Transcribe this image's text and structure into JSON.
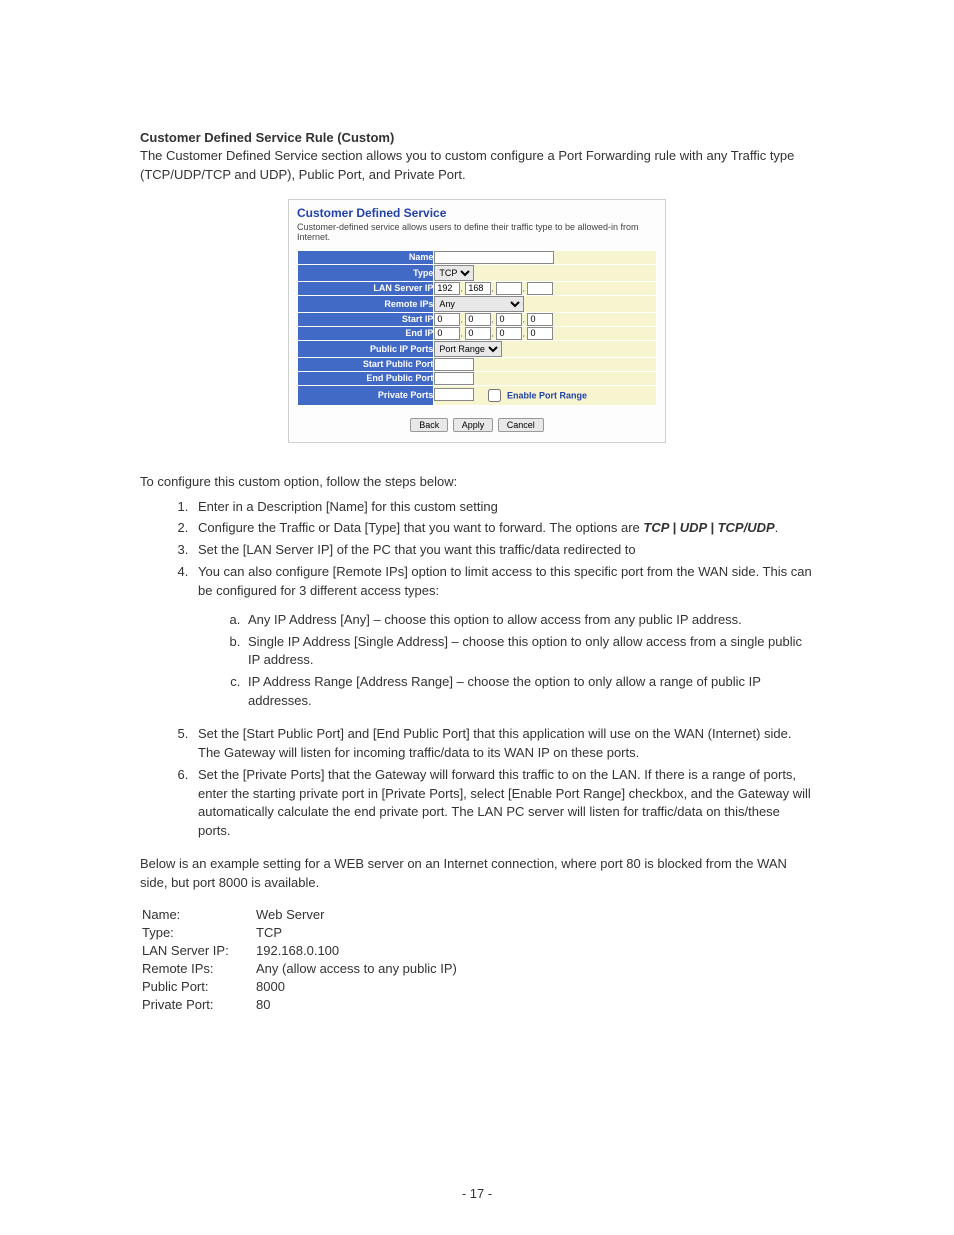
{
  "heading": "Customer Defined Service Rule (Custom)",
  "intro": "The Customer Defined Service section allows you to custom configure a Port Forwarding rule with any Traffic type (TCP/UDP/TCP and UDP), Public Port, and Private Port.",
  "shot": {
    "title": "Customer Defined Service",
    "desc": "Customer-defined service allows users to define their traffic type to be allowed-in from Internet.",
    "rows": {
      "name": "Name",
      "type": "Type",
      "lan_server_ip": "LAN Server IP",
      "remote_ips": "Remote IPs",
      "start_ip": "Start IP",
      "end_ip": "End IP",
      "public_ip_ports": "Public IP Ports",
      "start_public_port": "Start Public Port",
      "end_public_port": "End Public Port",
      "private_ports": "Private Ports"
    },
    "values": {
      "type_select": "TCP",
      "lan_ip_1": "192",
      "lan_ip_2": "168",
      "remote_select": "Any",
      "ip_zero": "0",
      "public_ports_select": "Port Range"
    },
    "checkbox_label": "Enable Port Range",
    "buttons": {
      "back": "Back",
      "apply": "Apply",
      "cancel": "Cancel"
    }
  },
  "configure_intro": "To configure this custom option, follow the steps below:",
  "steps": {
    "s1": "Enter in a Description [Name] for this custom setting",
    "s2a": "Configure the Traffic or Data [Type] that you want to forward.  The options are ",
    "s2b": "TCP | UDP | TCP/UDP",
    "s2c": ".",
    "s3": "Set the [LAN Server IP] of the PC that you want this traffic/data redirected to",
    "s4": "You can also configure [Remote IPs] option to limit access to this specific port from the WAN side. This can be configured for 3 different access types:",
    "s4a": "Any IP Address [Any] – choose this option to allow access from any public IP address.",
    "s4b": "Single IP Address [Single Address] – choose this option to only allow access from a single public IP address.",
    "s4c": "IP Address Range [Address Range] – choose the option to only allow a range of public IP addresses.",
    "s5": "Set the [Start Public Port] and [End Public Port] that this application will use on the WAN (Internet) side.  The Gateway will listen for incoming traffic/data to its WAN IP on these ports.",
    "s6": "Set the [Private Ports] that the Gateway will forward this traffic to on the LAN.  If there is a range of ports, enter the starting private port in [Private Ports], select [Enable Port Range] checkbox, and the Gateway will automatically calculate the end private port.  The LAN PC server will listen for traffic/data on this/these ports."
  },
  "example_intro": "Below is an example setting for a WEB server on an Internet connection, where port 80 is blocked from the WAN side, but port 8000 is available.",
  "example": {
    "name_l": "Name:",
    "name_v": "Web Server",
    "type_l": "Type:",
    "type_v": "TCP",
    "lan_l": "LAN Server IP:",
    "lan_v": "192.168.0.100",
    "remote_l": "Remote IPs:",
    "remote_v": "Any (allow access to any public IP)",
    "public_l": "Public Port:",
    "public_v": "8000",
    "private_l": "Private Port:",
    "private_v": "80"
  },
  "page_number": "- 17 -"
}
